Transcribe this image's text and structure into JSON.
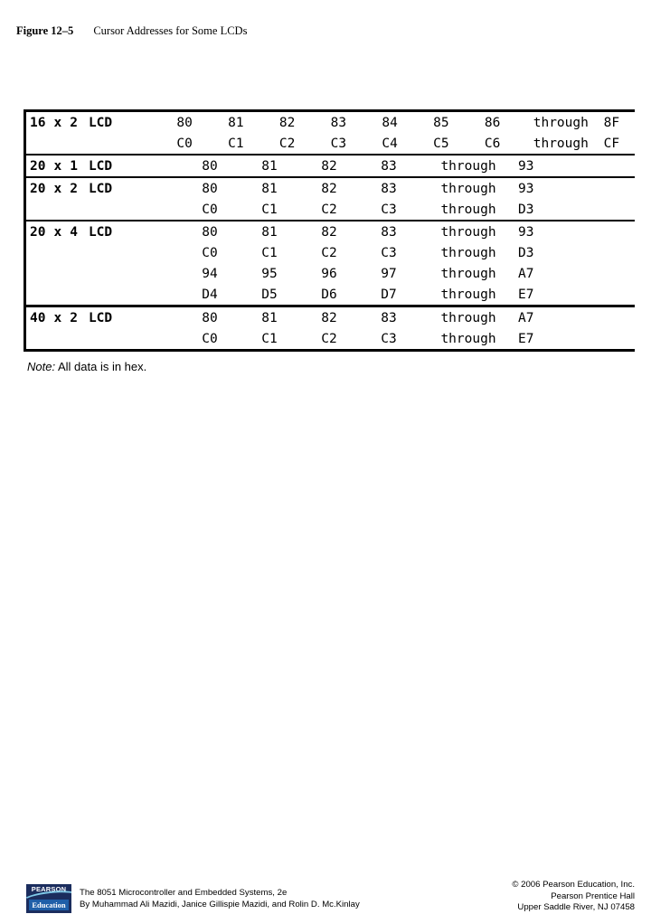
{
  "figure": {
    "label": "Figure 12–5",
    "title": "Cursor Addresses for Some LCDs"
  },
  "table": {
    "note_word": "Note:",
    "note_text": " All data is in hex.",
    "through_label": "through",
    "groups": [
      {
        "label": {
          "size": "16",
          "sep": "x",
          "rows": "2",
          "kind": "LCD"
        },
        "lines": [
          {
            "addresses": [
              "80",
              "81",
              "82",
              "83",
              "84",
              "85",
              "86"
            ],
            "end": "8F"
          },
          {
            "addresses": [
              "C0",
              "C1",
              "C2",
              "C3",
              "C4",
              "C5",
              "C6"
            ],
            "end": "CF"
          }
        ]
      },
      {
        "label": {
          "size": "20",
          "sep": "x",
          "rows": "1",
          "kind": "LCD"
        },
        "lines": [
          {
            "addresses": [
              "80",
              "81",
              "82",
              "83"
            ],
            "end": "93"
          }
        ]
      },
      {
        "label": {
          "size": "20",
          "sep": "x",
          "rows": "2",
          "kind": "LCD"
        },
        "lines": [
          {
            "addresses": [
              "80",
              "81",
              "82",
              "83"
            ],
            "end": "93"
          },
          {
            "addresses": [
              "C0",
              "C1",
              "C2",
              "C3"
            ],
            "end": "D3"
          }
        ]
      },
      {
        "label": {
          "size": "20",
          "sep": "x",
          "rows": "4",
          "kind": "LCD"
        },
        "lines": [
          {
            "addresses": [
              "80",
              "81",
              "82",
              "83"
            ],
            "end": "93"
          },
          {
            "addresses": [
              "C0",
              "C1",
              "C2",
              "C3"
            ],
            "end": "D3"
          },
          {
            "addresses": [
              "94",
              "95",
              "96",
              "97"
            ],
            "end": "A7"
          },
          {
            "addresses": [
              "D4",
              "D5",
              "D6",
              "D7"
            ],
            "end": "E7"
          }
        ]
      },
      {
        "label": {
          "size": "40",
          "sep": "x",
          "rows": "2",
          "kind": "LCD"
        },
        "lines": [
          {
            "addresses": [
              "80",
              "81",
              "82",
              "83"
            ],
            "end": "A7"
          },
          {
            "addresses": [
              "C0",
              "C1",
              "C2",
              "C3"
            ],
            "end": "E7"
          }
        ]
      }
    ]
  },
  "footer": {
    "logo": {
      "top_text": "PEARSON",
      "bottom_text": "Education",
      "bg_color": "#1b2d5e",
      "band_color": "#1f5fa8"
    },
    "book_title": "The 8051 Microcontroller and Embedded Systems, 2e",
    "book_authors": "By Muhammad Ali Mazidi, Janice Gillispie Mazidi, and Rolin D. Mc.Kinlay",
    "copyright_line1": "© 2006 Pearson Education, Inc.",
    "copyright_line2": "Pearson Prentice Hall",
    "copyright_line3": "Upper Saddle River, NJ 07458"
  }
}
